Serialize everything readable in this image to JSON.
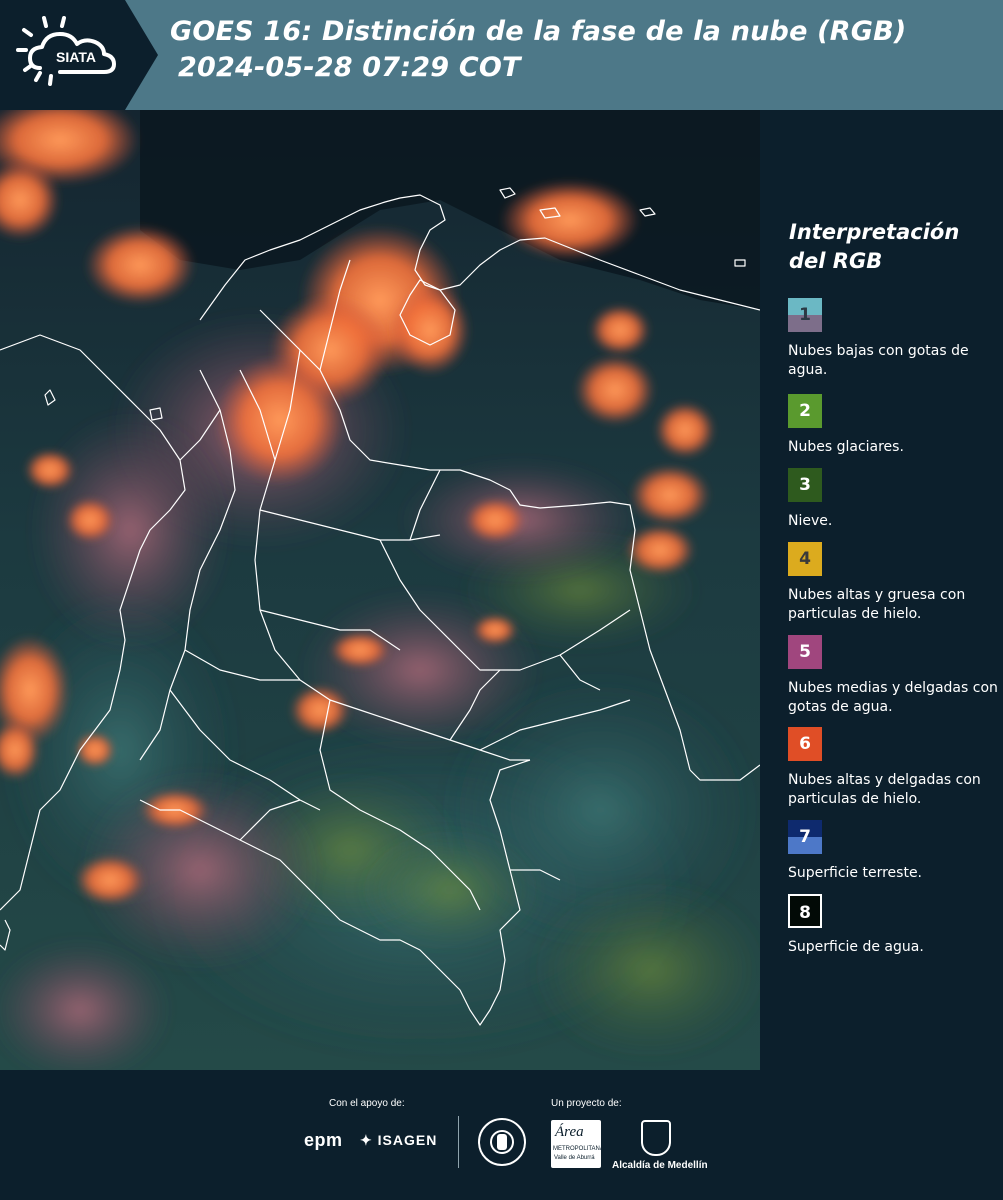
{
  "header": {
    "logo_text": "SIATA",
    "title_line1": "GOES 16: Distinción de la fase de la nube (RGB)",
    "title_line2": "2024-05-28 07:29 COT",
    "background_color": "#4d7888"
  },
  "map": {
    "description_icon": "satellite-rgb-cloud-phase-map",
    "boundary_color": "#ffffff"
  },
  "legend": {
    "title": "Interpretación del RGB",
    "items": [
      {
        "number": "1",
        "label": "Nubes bajas con gotas de agua.",
        "color_top": "#6bb8c4",
        "color_bottom": "#7d6e8a",
        "text_color": "#2b3a44"
      },
      {
        "number": "2",
        "label": "Nubes glaciares.",
        "color_top": "#5a9a2e",
        "color_bottom": "#5a9a2e",
        "text_color": "#ffffff"
      },
      {
        "number": "3",
        "label": "Nieve.",
        "color_top": "#2e5a1e",
        "color_bottom": "#2e5a1e",
        "text_color": "#ffffff"
      },
      {
        "number": "4",
        "label": "Nubes altas y gruesa con particulas de hielo.",
        "color_top": "#dcab1e",
        "color_bottom": "#dcab1e",
        "text_color": "#3a3a3a"
      },
      {
        "number": "5",
        "label": "Nubes medias y delgadas con gotas de agua.",
        "color_top": "#a0467e",
        "color_bottom": "#a0467e",
        "text_color": "#ffffff"
      },
      {
        "number": "6",
        "label": "Nubes altas y delgadas con particulas de hielo.",
        "color_top": "#e04e26",
        "color_bottom": "#e04e26",
        "text_color": "#ffffff"
      },
      {
        "number": "7",
        "label": "Superficie terreste.",
        "color_top": "#0e2a6e",
        "color_bottom": "#4d78c8",
        "text_color": "#ffffff"
      },
      {
        "number": "8",
        "label": "Superficie de agua.",
        "color_top": "#020a06",
        "color_bottom": "#020a06",
        "text_color": "#ffffff"
      }
    ]
  },
  "footer": {
    "support_label": "Con el apoyo de:",
    "project_label": "Un proyecto de:",
    "sponsor1": "epm",
    "sponsor2": "ISAGEN",
    "partner1_line1": "Área",
    "partner1_line2": "METROPOLITANA",
    "partner1_line3": "Valle de Aburrá",
    "partner2": "Alcaldía de Medellín"
  }
}
